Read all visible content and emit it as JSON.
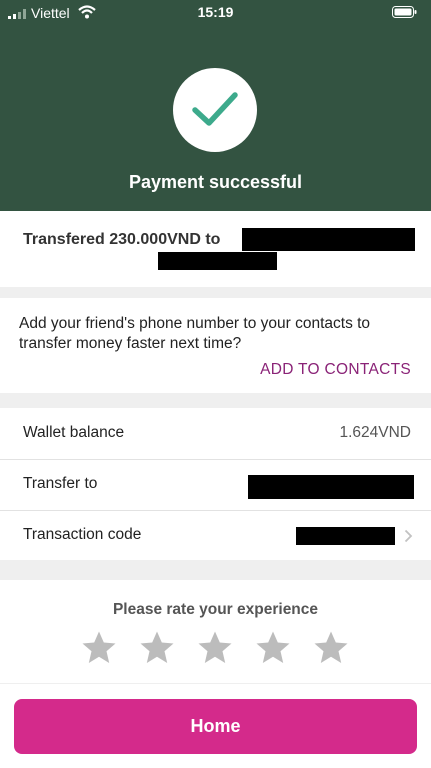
{
  "status_bar": {
    "carrier": "Viettel",
    "time": "15:19"
  },
  "header": {
    "title": "Payment successful",
    "icon": "check-icon",
    "icon_color": "#3daa8c",
    "background_color": "#335341"
  },
  "transfer_summary": {
    "text": "Transfered 230.000VND to"
  },
  "contacts_prompt": {
    "message": "Add your friend's phone number to your contacts to transfer money faster next time?",
    "action_label": "ADD TO CONTACTS"
  },
  "details": {
    "rows": [
      {
        "label": "Wallet balance",
        "value": "1.624VND"
      },
      {
        "label": "Transfer to",
        "value": ""
      },
      {
        "label": "Transaction code",
        "value": ""
      }
    ]
  },
  "rating": {
    "title": "Please rate your experience",
    "max_stars": 5,
    "selected": 0
  },
  "home_button": {
    "label": "Home",
    "color": "#d42a8b"
  }
}
